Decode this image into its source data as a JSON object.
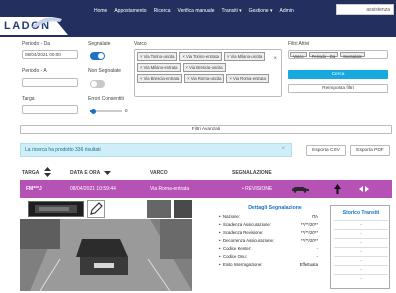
{
  "nav": {
    "logo": "LADON",
    "items": [
      "Home",
      "Appostamento",
      "Ricerca",
      "Verifica manuale",
      "Transiti ▾",
      "Gestione ▾",
      "Admin"
    ],
    "search_value": "assistenza"
  },
  "filters": {
    "periodo_da_label": "Periodo - Da",
    "periodo_da_value": "08/04/2021 00:00",
    "periodo_a_label": "Periodo - A",
    "periodo_a_value": "",
    "targa_label": "Targa",
    "targa_value": "",
    "segnalate_label": "Segnalate",
    "segnalate_on": true,
    "non_segnalate_label": "Non Segnalate",
    "non_segnalate_on": false,
    "errori_label": "Errori Consentiti",
    "errori_value": "0",
    "varco_label": "Varco",
    "varco_chips": [
      "× Via Torino-uscita",
      "× Via Torino-entrata",
      "× Via Milano-uscita",
      "× Via Milano-entrata",
      "× Via Brescia-uscita",
      "× Via Brescia-entrata",
      "× Via Roma-uscita",
      "× Via Roma-entrata"
    ],
    "varco_clear": "×",
    "filtri_attivi_label": "Filtri Attivi",
    "filtri_attivi_chips": [
      "Varco",
      "Periodo - Da",
      "Segnalate"
    ],
    "cerca_label": "Cerca",
    "reimposta_label": "Reimposta filtri",
    "avanzati_label": "Filtri Avanzati"
  },
  "alert": {
    "text": "La ricerca ha prodotto 336 risultati",
    "close": "×"
  },
  "export": {
    "csv_label": "Esporta CSV",
    "pdf_label": "Esporta PDF"
  },
  "table": {
    "headers": [
      "TARGA",
      "DATA E ORA",
      "VARCO",
      "SEGNALAZIONE"
    ],
    "row": {
      "targa": "FM***J",
      "data": "08/04/2021 10:59:44",
      "varco": "Via Roma-entrata",
      "segnalazione": "• REVISIONE"
    }
  },
  "detail": {
    "title": "Dettagli Segnalazione",
    "items": [
      {
        "label": "Nazione:",
        "value": "ITA"
      },
      {
        "label": "Scadenza Assicurazione:",
        "value": "**/**/20**"
      },
      {
        "label": "Scadenza Revisione:",
        "value": "**/**/20**"
      },
      {
        "label": "Decorrenza Assicurazione:",
        "value": "**/**/20**"
      },
      {
        "label": "Codice Kenter:",
        "value": "-"
      },
      {
        "label": "Codice Onu:",
        "value": "-"
      },
      {
        "label": "Esito Interrogazione:",
        "value": "Effettuata"
      }
    ],
    "storico_title": "Storico Transiti",
    "storico_rows": [
      "-",
      "-",
      "-",
      "-",
      "-",
      "-",
      "-"
    ]
  },
  "colors": {
    "navbar": "#232f5f",
    "accent": "#1a73c4",
    "row_highlight": "#b652b6",
    "primary_button": "#17a8e0",
    "alert_bg": "#cfeef7"
  }
}
